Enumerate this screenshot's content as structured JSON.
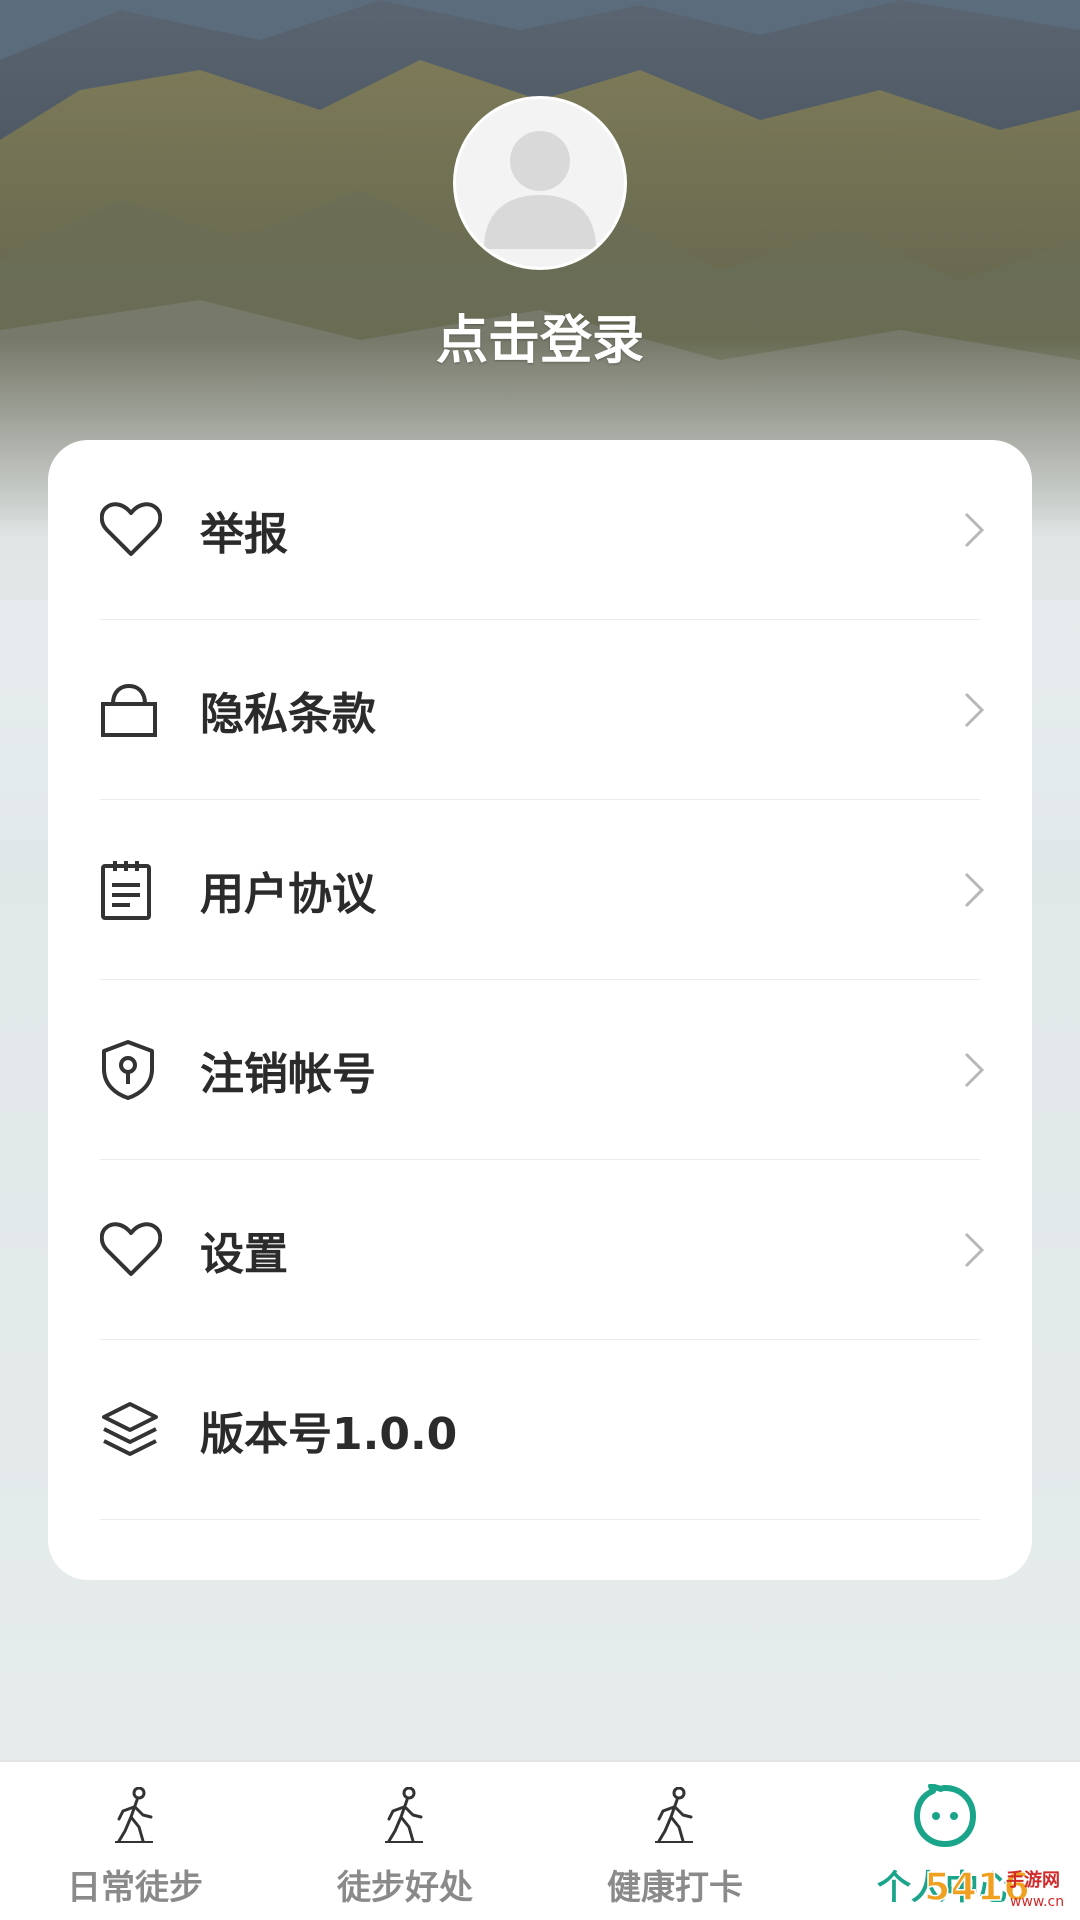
{
  "header": {
    "login_text": "点击登录"
  },
  "menu": {
    "items": [
      {
        "label": "举报",
        "icon": "heart-icon"
      },
      {
        "label": "隐私条款",
        "icon": "lock-icon"
      },
      {
        "label": "用户协议",
        "icon": "document-icon"
      },
      {
        "label": "注销帐号",
        "icon": "shield-key-icon"
      },
      {
        "label": "设置",
        "icon": "heart-icon"
      },
      {
        "label": "版本号1.0.0",
        "icon": "layers-icon"
      }
    ]
  },
  "bottom_nav": {
    "items": [
      {
        "label": "日常徒步",
        "icon": "walking-icon",
        "active": false
      },
      {
        "label": "徒步好处",
        "icon": "walking-icon",
        "active": false
      },
      {
        "label": "健康打卡",
        "icon": "walking-icon",
        "active": false
      },
      {
        "label": "个人中心",
        "icon": "smiley-chat-icon",
        "active": true
      }
    ]
  },
  "watermark": {
    "brand": "5416",
    "text": "手游网",
    "domain": "www.cn"
  },
  "colors": {
    "accent": "#1aa58a",
    "card_bg": "#ffffff",
    "label": "#2b2b2b",
    "inactive_nav": "#8a8a8a"
  }
}
